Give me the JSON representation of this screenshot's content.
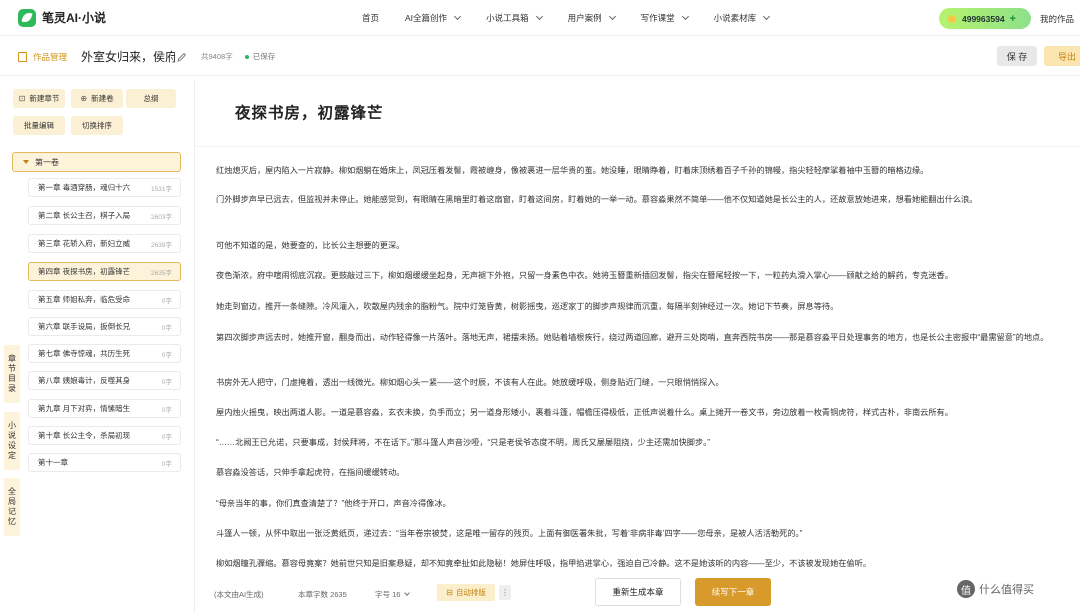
{
  "app": {
    "name": "笔灵AI·小说"
  },
  "nav": {
    "items": [
      {
        "label": "首页",
        "dropdown": false
      },
      {
        "label": "AI全篇创作",
        "dropdown": true
      },
      {
        "label": "小说工具箱",
        "dropdown": true
      },
      {
        "label": "用户案例",
        "dropdown": true
      },
      {
        "label": "写作课堂",
        "dropdown": true
      },
      {
        "label": "小说素材库",
        "dropdown": true
      }
    ],
    "points": "499963594",
    "my_works": "我的作品"
  },
  "subbar": {
    "manage_label": "作品管理",
    "book_title": "外室女归来，侯府扌",
    "word_count": "共9408字",
    "saved_status": "已保存",
    "save_label": "保 存",
    "export_label": "导出"
  },
  "sidebar": {
    "tools": {
      "new_chapter": "新建章节",
      "new_volume": "新建卷",
      "outline": "总纲",
      "batch_edit": "批量编辑",
      "switch_sort": "切换排序"
    },
    "volume": "第一卷",
    "chapters": [
      {
        "title": "第一章 毒酒穿肠，魂归十六",
        "count": "1531字"
      },
      {
        "title": "第二章 长公主召，棋子入局",
        "count": "2603字"
      },
      {
        "title": "第三章 花轿入府，新妇立威",
        "count": "2639字"
      },
      {
        "title": "第四章 夜探书房，初露锋芒",
        "count": "2635字"
      },
      {
        "title": "第五章 师姐私奔，临危受命",
        "count": "0字"
      },
      {
        "title": "第六章 联手设局，扳倒长兄",
        "count": "0字"
      },
      {
        "title": "第七章 佛寺惊魂，共历生死",
        "count": "0字"
      },
      {
        "title": "第八章 姨娘毒计，反噬其身",
        "count": "0字"
      },
      {
        "title": "第九章 月下对弈，情愫暗生",
        "count": "0字"
      },
      {
        "title": "第十章 长公主令，杀局初现",
        "count": "0字"
      },
      {
        "title": "第十一章",
        "count": "0字"
      }
    ],
    "side_tabs": [
      "章节目录",
      "小说设定",
      "全局记忆"
    ]
  },
  "editor": {
    "chapter_title": "夜探书房，初露锋芒",
    "paragraphs": [
      "红烛熄灭后，屋内陷入一片寂静。柳如烟躺在婚床上，凤冠压着发髻，霞被缠身，像被裹进一层华贵的茧。她没睡，眼睛睁着，盯着床顶绣着百子千孙的锦幔，指尖轻轻摩挲着袖中玉簪的暗格边缘。",
      "门外脚步声早已远去，但监视并未停止。她能感觉到，有眼睛在黑暗里盯着这扇窗，盯着这间房，盯着她的一举一动。慕容淼果然不简单——他不仅知道她是长公主的人，还故意放她进来，想看她能翻出什么浪。",
      "可他不知道的是，她要查的，比长公主想要的更深。",
      "夜色渐浓，府中喧闹彻底沉寂。更鼓敲过三下，柳如烟缓缓坐起身，无声褪下外袍，只留一身素色中衣。她将玉簪重新插回发髻，指尖在簪尾轻按一下，一粒药丸滑入掌心——顾献之给的解药，专克迷香。",
      "她走到窗边，推开一条缝隙。冷风灌入，吹散屋内残余的脂粉气。院中灯笼昏黄，树影摇曳，巡逻家丁的脚步声规律而沉重，每隔半刻钟经过一次。她记下节奏，屏息等待。",
      "第四次脚步声远去时，她推开窗，翻身而出，动作轻得像一片落叶。落地无声，裙摆未扬。她贴着墙根疾行，绕过两道回廊，避开三处岗哨，直奔西院书房——那是慕容淼平日处理事务的地方，也是长公主密报中“最需留意”的地点。",
      "书房外无人把守，门虚掩着，透出一线微光。柳如烟心头一紧——这个时辰，不该有人在此。她放缓呼吸，侧身贴近门缝，一只眼悄悄探入。",
      "屋内烛火摇曳，映出两道人影。一道是慕容淼，玄衣未换，负手而立；另一道身形矮小，裹着斗篷，帽檐压得极低，正低声说着什么。桌上摊开一卷文书，旁边放着一枚青铜虎符，样式古朴，非南云所有。",
      "“……北阙王已允诺，只要事成，封侯拜将，不在话下。”那斗篷人声音沙哑，“只是老侯爷态度不明，周氏又屡屡阻挠，少主还需加快脚步。”",
      "慕容淼没答话，只伸手拿起虎符，在指间缓缓转动。",
      "“母亲当年的事，你们真查清楚了？”他终于开口，声音冷得像冰。",
      "斗篷人一顿，从怀中取出一张泛黄纸页，递过去：“当年卷宗被焚，这是唯一留存的残页。上面有御医署朱批，写着‘非病非毒’四字——您母亲，是被人活活勒死的。”",
      "柳如烟瞳孔骤缩。慕容母竟案？她前世只知是旧案悬疑，却不知竟牵扯如此隐秘！她屏住呼吸，指甲掐进掌心，强迫自己冷静。这不是她该听的内容——至少，不该被发现她在偷听。"
    ]
  },
  "bottom": {
    "note": "(本文由AI生成)",
    "chapter_count": "本章字数 2635",
    "font_size": "字号 16",
    "auto_layout": "自动排版",
    "more": "⋮",
    "regenerate": "重新生成本章",
    "continue": "续写下一章"
  },
  "watermark": {
    "text": "什么值得买",
    "logo": "值"
  },
  "colors": {
    "accent": "#d89a2b",
    "brand_green": "#2fb95a",
    "highlight_bg": "#fcf3da"
  }
}
